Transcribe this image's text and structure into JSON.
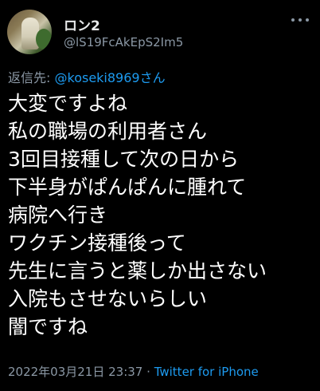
{
  "author": {
    "display_name": "ロン2",
    "handle": "@lS19FcAkEpS2Im5"
  },
  "reply": {
    "label": "返信先:",
    "to_handle": "@koseki8969さん"
  },
  "body_lines": [
    "大変ですよね",
    "私の職場の利用者さん",
    "3回目接種して次の日から",
    "下半身がぱんぱんに腫れて",
    "病院へ行き",
    "ワクチン接種後って",
    "先生に言うと薬しか出さない",
    "入院もさせないらしい",
    "闇ですね"
  ],
  "meta": {
    "timestamp": "2022年03月21日 23:37",
    "separator": "·",
    "source": "Twitter for iPhone"
  },
  "colors": {
    "background": "#000000",
    "text": "#ffffff",
    "muted": "#8b98a5",
    "link": "#1d9bf0"
  },
  "icons": {
    "more": "more-horizontal-icon"
  }
}
